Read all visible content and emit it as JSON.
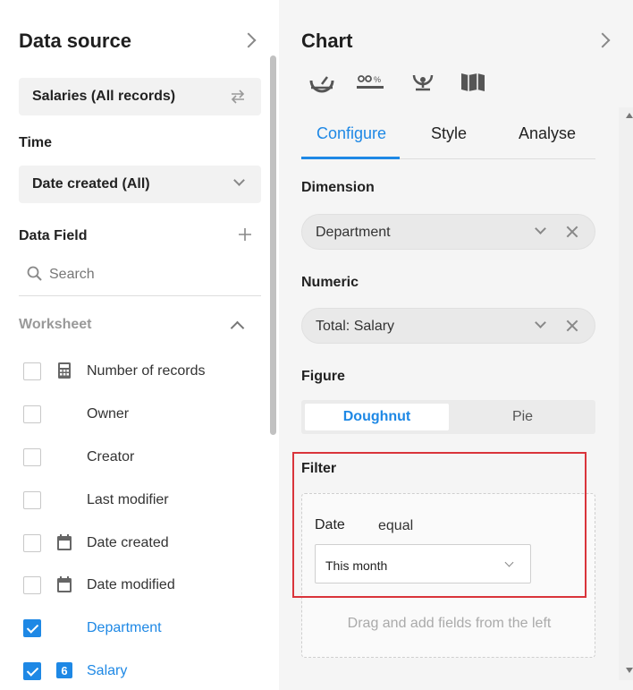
{
  "data_source": {
    "title": "Data source",
    "source_label": "Salaries (All records)",
    "time_label": "Time",
    "time_value": "Date created (All)",
    "data_field_label": "Data Field",
    "search_placeholder": "Search",
    "worksheet_label": "Worksheet",
    "fields": [
      {
        "label": "Number of records",
        "icon": "calculator-icon",
        "checked": false
      },
      {
        "label": "Owner",
        "icon": "",
        "checked": false
      },
      {
        "label": "Creator",
        "icon": "",
        "checked": false
      },
      {
        "label": "Last modifier",
        "icon": "",
        "checked": false
      },
      {
        "label": "Date created",
        "icon": "calendar-icon",
        "checked": false
      },
      {
        "label": "Date modified",
        "icon": "calendar-icon",
        "checked": false
      },
      {
        "label": "Department",
        "icon": "",
        "checked": true
      },
      {
        "label": "Salary",
        "icon": "number-icon",
        "checked": true
      }
    ]
  },
  "chart": {
    "title": "Chart",
    "chart_type_icons": [
      "gauge-icon",
      "percent-bar-icon",
      "funnel-icon",
      "map-icon"
    ],
    "tabs": [
      "Configure",
      "Style",
      "Analyse"
    ],
    "active_tab": "Configure",
    "dimension_label": "Dimension",
    "dimension_value": "Department",
    "numeric_label": "Numeric",
    "numeric_value": "Total: Salary",
    "figure_label": "Figure",
    "figure_options": [
      "Doughnut",
      "Pie"
    ],
    "figure_selected": "Doughnut",
    "filter_label": "Filter",
    "filter_field": "Date",
    "filter_operator": "equal",
    "filter_value": "This month",
    "filter_hint": "Drag and add fields from the left",
    "accent_color": "#1e88e5",
    "highlight_color": "#d9343b"
  }
}
